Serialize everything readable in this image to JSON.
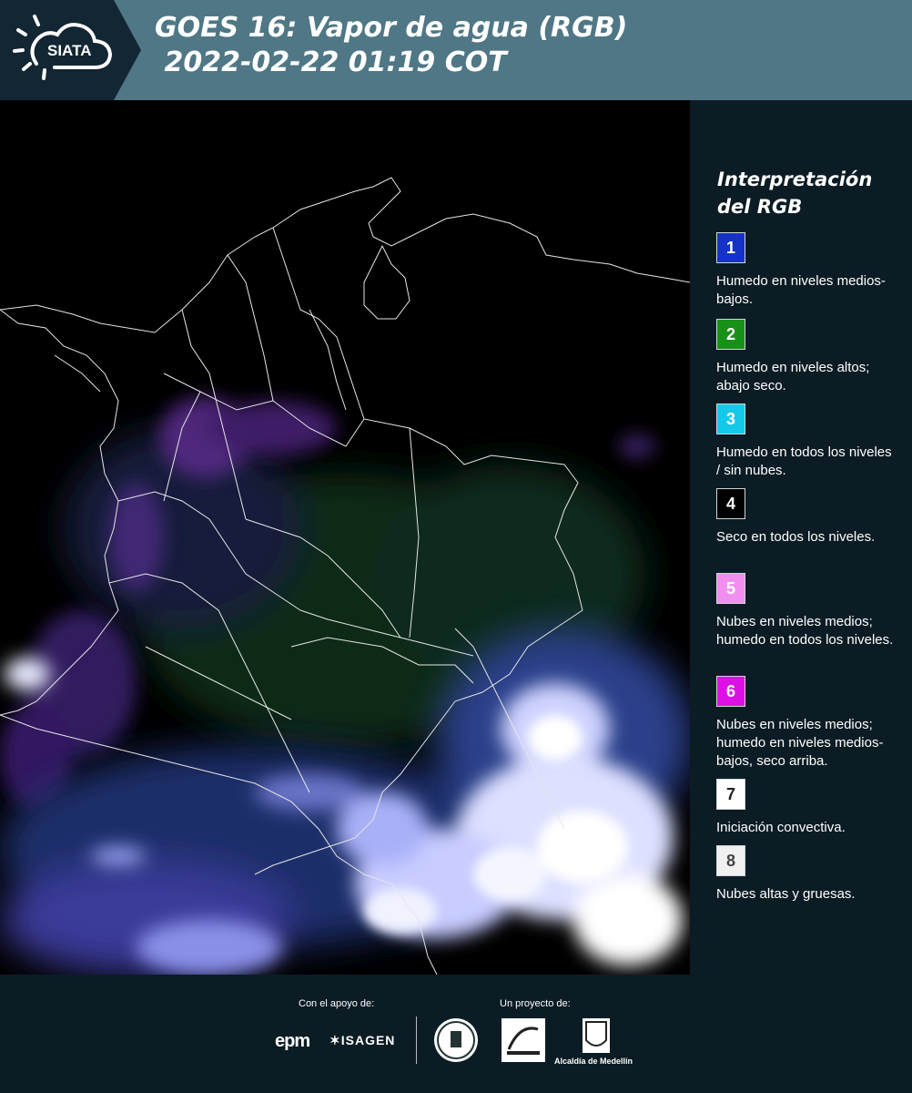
{
  "header": {
    "logo_text": "SIATA",
    "title_line1": "GOES 16: Vapor de agua (RGB)",
    "title_line2": " 2022-02-22 01:19 COT"
  },
  "legend": {
    "title": "Interpretación del RGB",
    "items": [
      {
        "number": "1",
        "color": "#1433c4",
        "text_color": "#ffffff",
        "label": "Humedo en niveles medios-bajos."
      },
      {
        "number": "2",
        "color": "#179117",
        "text_color": "#ffffff",
        "label": "Humedo en niveles altos; abajo seco."
      },
      {
        "number": "3",
        "color": "#14c8ea",
        "text_color": "#ffffff",
        "label": "Humedo en todos los niveles / sin nubes."
      },
      {
        "number": "4",
        "color": "#000000",
        "text_color": "#ffffff",
        "label": "Seco en todos los niveles."
      },
      {
        "number": "5",
        "color": "#f28ef0",
        "text_color": "#ffffff",
        "label": "Nubes en niveles medios; humedo en todos los niveles."
      },
      {
        "number": "6",
        "color": "#dd10e6",
        "text_color": "#ffffff",
        "label": "Nubes en niveles medios; humedo en niveles medios-bajos, seco arriba."
      },
      {
        "number": "7",
        "color": "#ffffff",
        "text_color": "#222222",
        "label": "Iniciación convectiva."
      },
      {
        "number": "8",
        "color": "#f0f0f0",
        "text_color": "#444444",
        "label": "Nubes altas y gruesas."
      }
    ]
  },
  "footer": {
    "support_label": "Con el apoyo de:",
    "project_label": "Un proyecto de:",
    "sponsor1": "epm",
    "sponsor2": "ISAGEN",
    "partner_label": "Alcaldía de Medellín"
  },
  "map": {
    "icon": "satellite-water-vapor-map",
    "cloud_color": "#dde2ff",
    "moist_color": "#2a4a6a",
    "mid_cloud_color": "#6a2a9a"
  }
}
